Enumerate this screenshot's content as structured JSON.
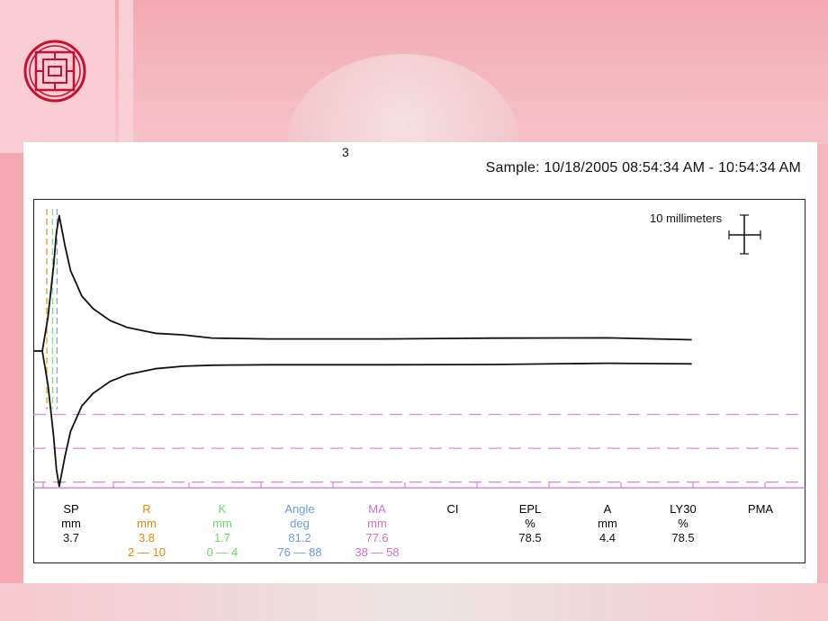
{
  "page_number": "3",
  "sample_label": "Sample: 10/18/2005 08:54:34 AM - 10:54:34 AM",
  "scale_label": "10 millimeters",
  "colors": {
    "trace": "#111111",
    "sp": "#000000",
    "r": "#e08a00",
    "k": "#66dd66",
    "angle": "#6b9bdb",
    "ma": "#d070d0",
    "threshold_line": "#d88ad8"
  },
  "stats": [
    {
      "name": "SP",
      "unit": "mm",
      "value": "3.7",
      "range": "",
      "color": "#000000"
    },
    {
      "name": "R",
      "unit": "mm",
      "value": "3.8",
      "range": "2 — 10",
      "color": "#e08a00"
    },
    {
      "name": "K",
      "unit": "mm",
      "value": "1.7",
      "range": "0 — 4",
      "color": "#66dd66"
    },
    {
      "name": "Angle",
      "unit": "deg",
      "value": "81.2",
      "range": "76 — 88",
      "color": "#6b9bdb"
    },
    {
      "name": "MA",
      "unit": "mm",
      "value": "77.6",
      "range": "38 — 58",
      "color": "#d070d0"
    },
    {
      "name": "CI",
      "unit": "",
      "value": "",
      "range": "",
      "color": "#000000"
    },
    {
      "name": "EPL",
      "unit": "%",
      "value": "78.5",
      "range": "",
      "color": "#000000"
    },
    {
      "name": "A",
      "unit": "mm",
      "value": "4.4",
      "range": "",
      "color": "#000000"
    },
    {
      "name": "LY30",
      "unit": "%",
      "value": "78.5",
      "range": "",
      "color": "#000000"
    },
    {
      "name": "PMA",
      "unit": "",
      "value": "",
      "range": "",
      "color": "#000000"
    }
  ],
  "chart_data": {
    "type": "line",
    "title": "",
    "xlabel": "",
    "ylabel": "",
    "xlim": [
      0,
      120
    ],
    "ylim": [
      -40,
      40
    ],
    "grid": false,
    "series": [
      {
        "x": [
          0,
          1,
          2,
          2.5,
          3,
          4,
          5,
          7,
          9,
          12,
          15,
          20,
          25,
          30,
          40,
          60,
          80,
          100,
          115
        ],
        "values": [
          0,
          8,
          20,
          28,
          32,
          25,
          19,
          13,
          10,
          7.2,
          5.6,
          4.2,
          3.6,
          3.3,
          3.1,
          3.0,
          3.0,
          2.9,
          2.9
        ]
      },
      {
        "x": [
          0,
          1,
          2,
          2.5,
          3,
          4,
          5,
          7,
          9,
          12,
          15,
          20,
          25,
          30,
          40,
          60,
          80,
          100,
          115
        ],
        "values": [
          0,
          -8,
          -20,
          -28,
          -32,
          -25,
          -19,
          -13,
          -10,
          -7.2,
          -5.6,
          -4.2,
          -3.6,
          -3.3,
          -3.1,
          -3.0,
          -3.0,
          -2.9,
          -2.9
        ]
      }
    ],
    "reference_lines": [
      {
        "y": -15,
        "color": "#d88ad8"
      },
      {
        "y": -23,
        "color": "#d88ad8"
      },
      {
        "y": -31,
        "color": "#d88ad8"
      }
    ],
    "markers": [
      {
        "label": "R",
        "x": 0.8,
        "color": "#e08a00"
      },
      {
        "label": "K",
        "x": 1.8,
        "color": "#66dd66"
      },
      {
        "label": "Angle",
        "x": 2.6,
        "color": "#6b9bdb"
      }
    ]
  }
}
